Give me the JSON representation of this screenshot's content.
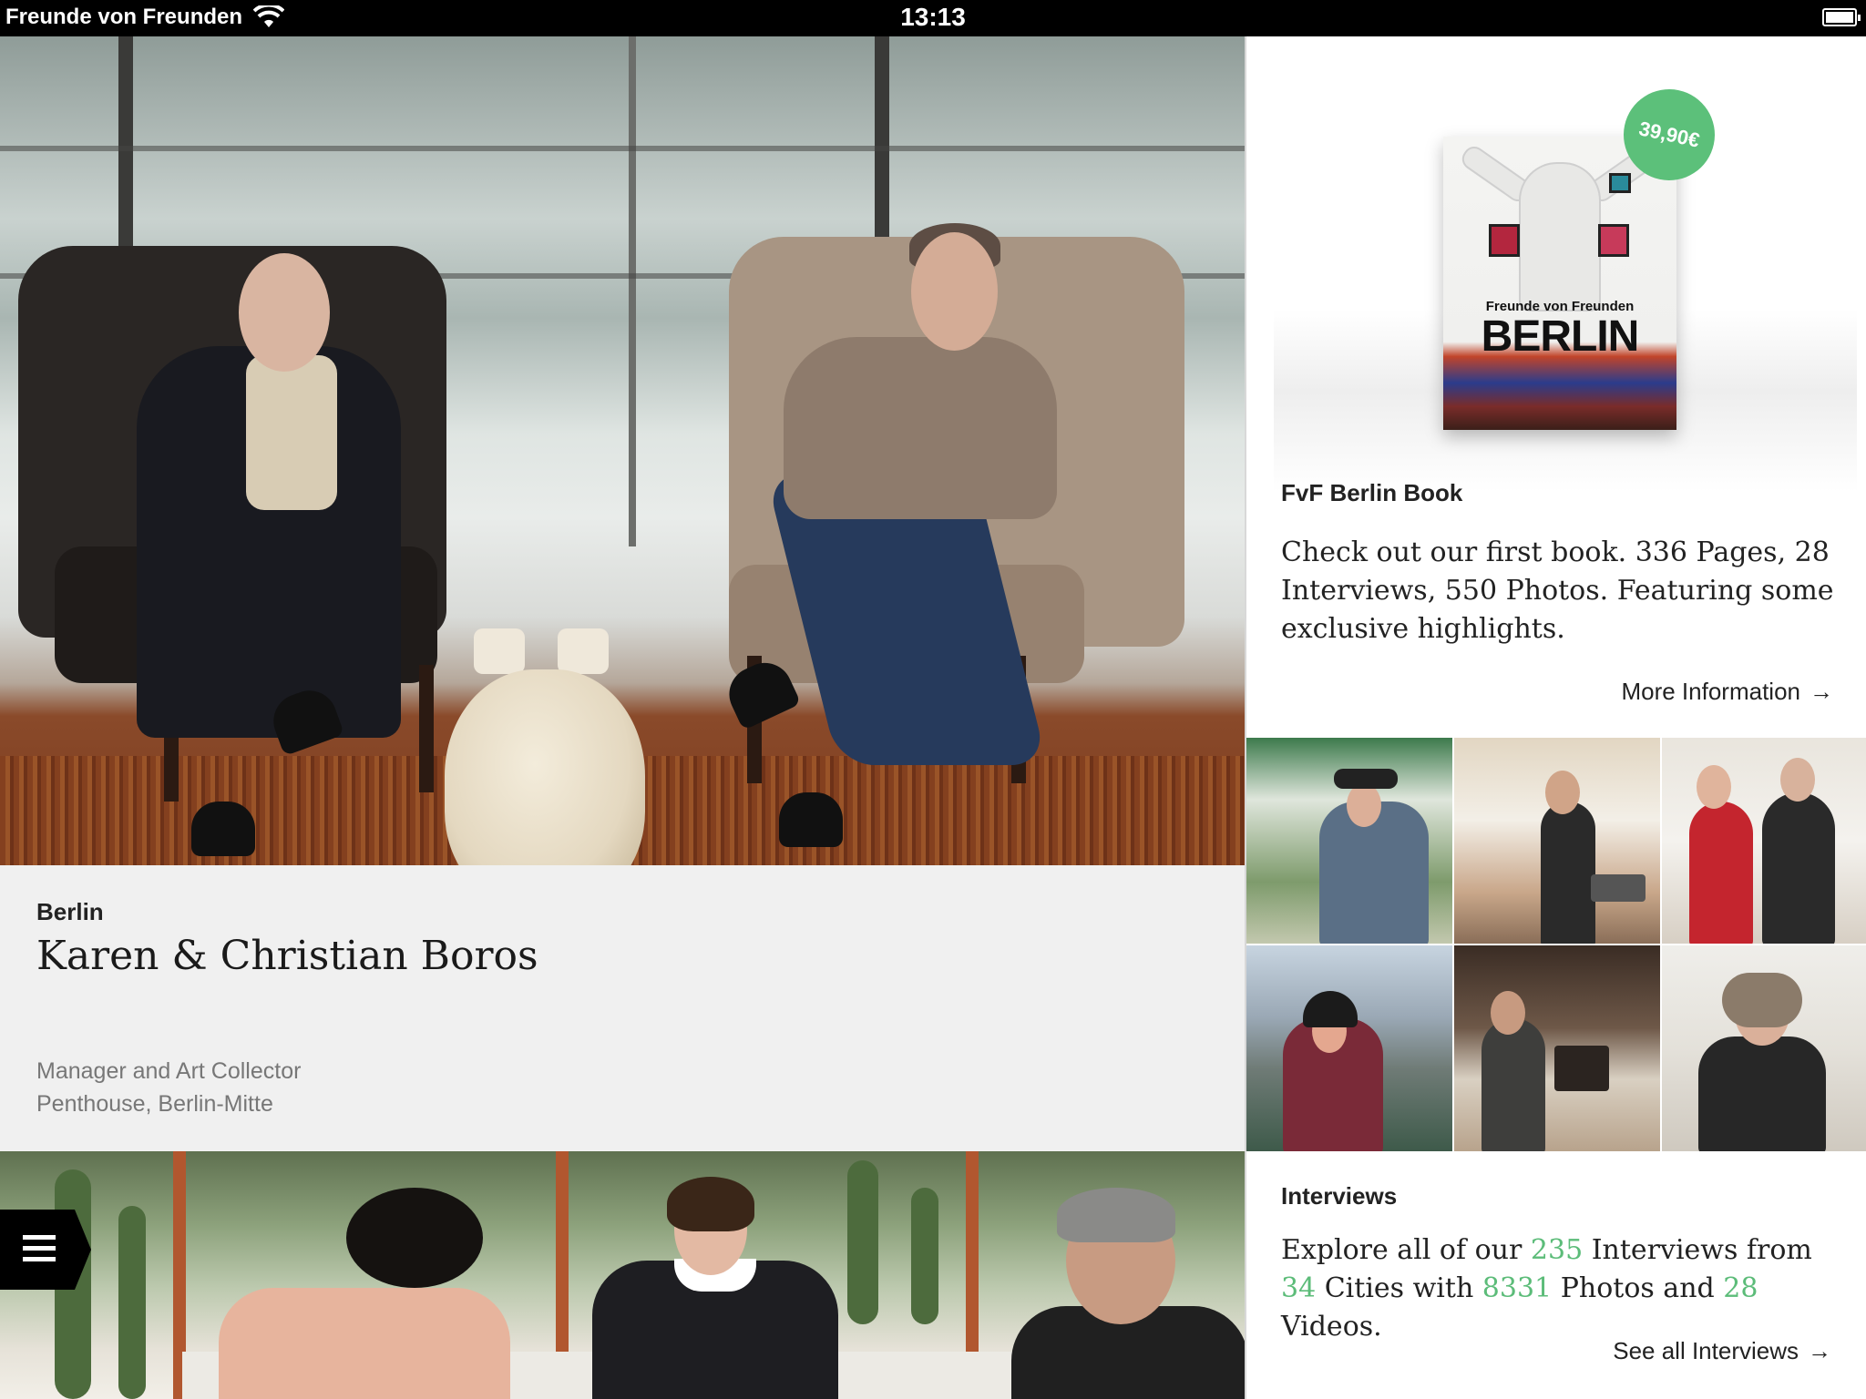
{
  "status_bar": {
    "carrier": "Freunde von Freunden",
    "time": "13:13"
  },
  "feature": {
    "city": "Berlin",
    "title": "Karen & Christian Boros",
    "role": "Manager and Art Collector",
    "location": "Penthouse, Berlin-Mitte"
  },
  "book": {
    "price": "39,90€",
    "cover_subtitle": "Freunde von Freunden",
    "cover_title": "BERLIN",
    "heading": "FvF Berlin Book",
    "description": "Check out our first book. 336 Pages, 28 Interviews, 550 Photos. Featuring some exclusive highlights.",
    "link": "More Information"
  },
  "interviews": {
    "heading": "Interviews",
    "text_1": "Explore all of our ",
    "interviews_count": "235",
    "text_2": " Interviews from ",
    "cities_count": "34",
    "text_3": " Cities with ",
    "photos_count": "8331",
    "text_4": " Photos and ",
    "videos_count": "28",
    "text_5": " Videos.",
    "link": "See all Interviews"
  },
  "icons": {
    "arrow": "→",
    "menu": "hamburger-menu-icon",
    "wifi": "wifi-icon",
    "battery": "battery-icon"
  },
  "colors": {
    "accent_green": "#5cbc79",
    "status_bar": "#000000",
    "caption_background": "#f0f0f0"
  }
}
